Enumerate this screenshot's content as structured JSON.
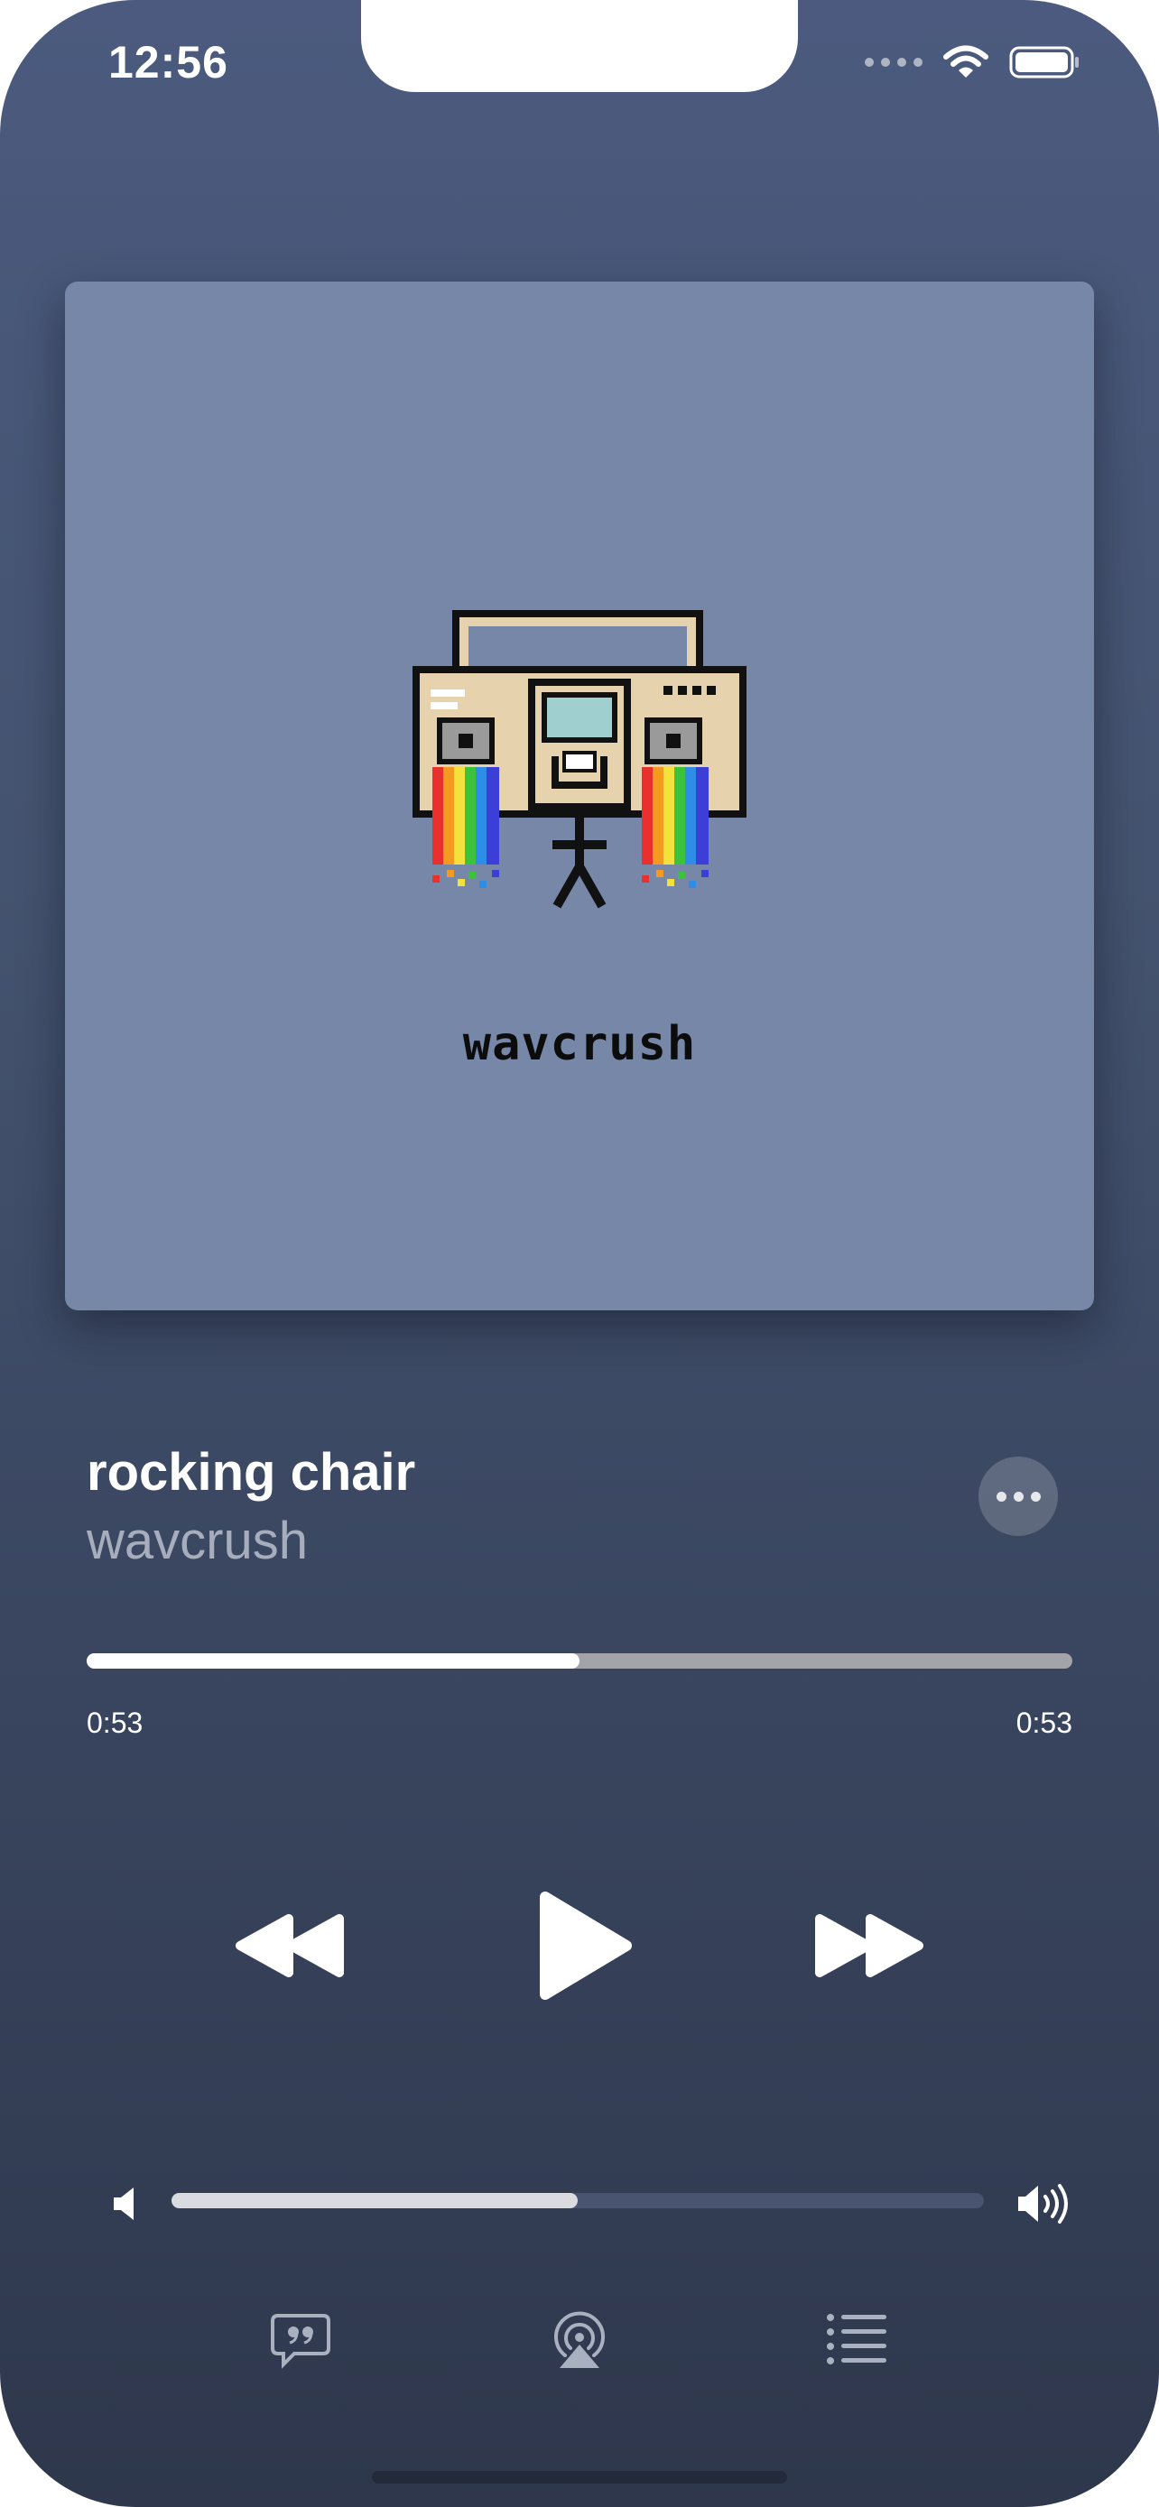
{
  "status_bar": {
    "time": "12:56"
  },
  "artwork": {
    "brand_text": "wavcrush"
  },
  "now_playing": {
    "title": "rocking chair",
    "artist": "wavcrush",
    "elapsed": "0:53",
    "remaining": "0:53",
    "progress_fraction": 0.5
  },
  "volume": {
    "level_fraction": 0.5
  },
  "icons": {
    "more": "ellipsis-icon",
    "rewind": "rewind-icon",
    "play": "play-icon",
    "forward": "fast-forward-icon",
    "volume_low": "speaker-low-icon",
    "volume_high": "speaker-high-icon",
    "lyrics": "lyrics-bubble-icon",
    "airplay": "airplay-icon",
    "queue": "queue-list-icon"
  },
  "colors": {
    "background_top": "#4b5a7e",
    "background_bottom": "#2e374c",
    "artwork_bg": "#7787a8",
    "secondary_text": "#a6adbd"
  }
}
